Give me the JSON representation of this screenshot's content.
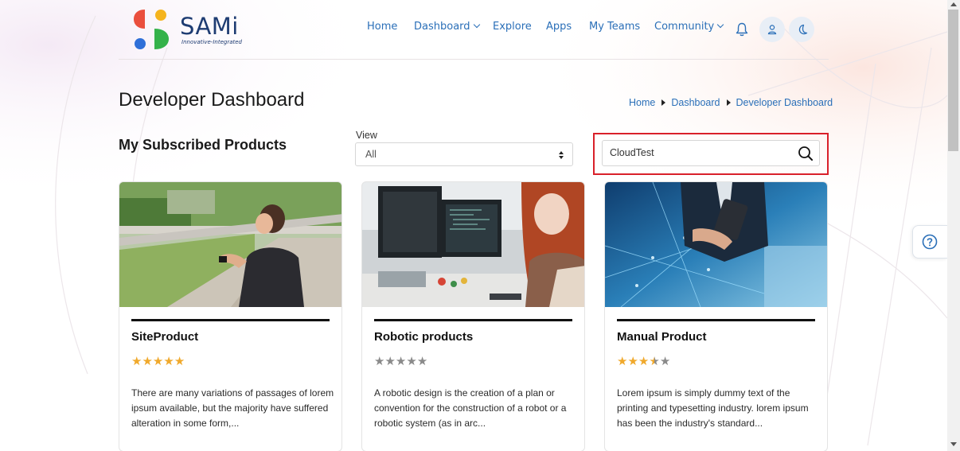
{
  "brand": {
    "name": "SAMi",
    "tagline": "Innovative-Integrated"
  },
  "nav": {
    "items": [
      {
        "label": "Home"
      },
      {
        "label": "Dashboard"
      },
      {
        "label": "Explore"
      },
      {
        "label": "Apps"
      },
      {
        "label": "My Teams"
      },
      {
        "label": "Community"
      }
    ],
    "icons": [
      "bell-icon",
      "user-icon",
      "moon-icon"
    ]
  },
  "page": {
    "title": "Developer Dashboard"
  },
  "breadcrumb": [
    "Home",
    "Dashboard",
    "Developer Dashboard"
  ],
  "subscribed": {
    "title": "My Subscribed Products",
    "view_label": "View",
    "view_selected": "All"
  },
  "search": {
    "value": "CloudTest"
  },
  "products": [
    {
      "title": "SiteProduct",
      "rating": 5,
      "description": "There are many variations of passages of lorem ipsum available, but the majority have suffered alteration in some form,..."
    },
    {
      "title": "Robotic products",
      "rating": 0,
      "description": "A robotic design is the creation of a plan or convention for the construction of a robot or a robotic system (as in arc..."
    },
    {
      "title": "Manual Product",
      "rating": 3.5,
      "description": "Lorem ipsum is simply dummy text of the printing and typesetting industry. lorem ipsum has been the industry's standard..."
    }
  ],
  "colors": {
    "accent": "#2a6fb8",
    "star_filled": "#f0a92c",
    "star_empty": "#8a8a8a",
    "highlight": "#d9202a"
  }
}
